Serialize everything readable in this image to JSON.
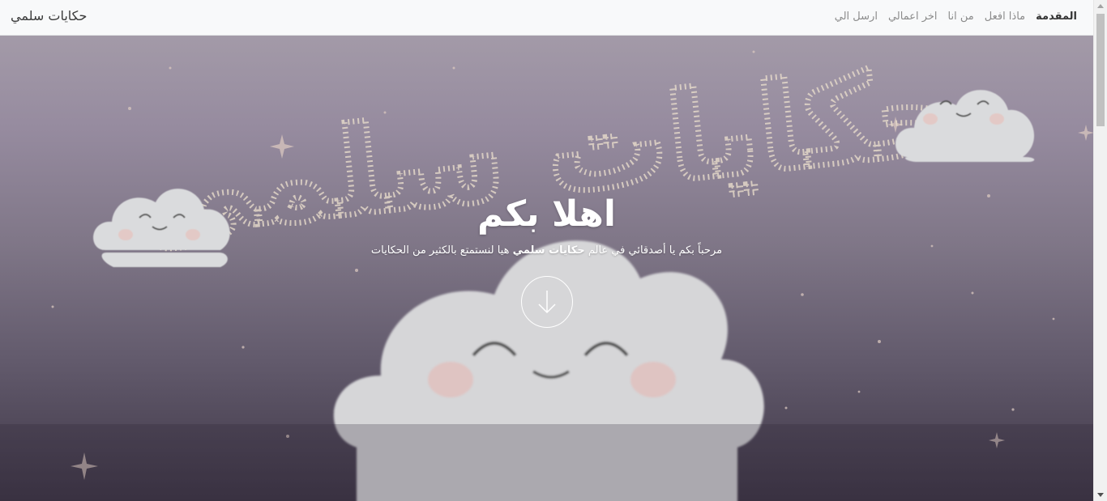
{
  "navbar": {
    "brand": "حكايات سلمي",
    "links": [
      {
        "label": "المقدمة",
        "active": true
      },
      {
        "label": "ماذا افعل",
        "active": false
      },
      {
        "label": "من انا",
        "active": false
      },
      {
        "label": "اخر اعمالي",
        "active": false
      },
      {
        "label": "ارسل الي",
        "active": false
      }
    ]
  },
  "hero": {
    "title": "اهلا بكم",
    "subtitle_pre": "مرحباً بكم يا أصدقائي في عالم",
    "subtitle_bold": "حكايات سلمي",
    "subtitle_post": "هيا لنستمتع بالكثير من الحكايات",
    "artwork_text": "حكايات سلمى",
    "down_button_icon": "arrow-down-circle-icon"
  },
  "colors": {
    "navbar_bg": "#f8f9fa",
    "active_link": "#333333",
    "inactive_link": "#8c8c8c",
    "hero_text": "#ffffff"
  }
}
